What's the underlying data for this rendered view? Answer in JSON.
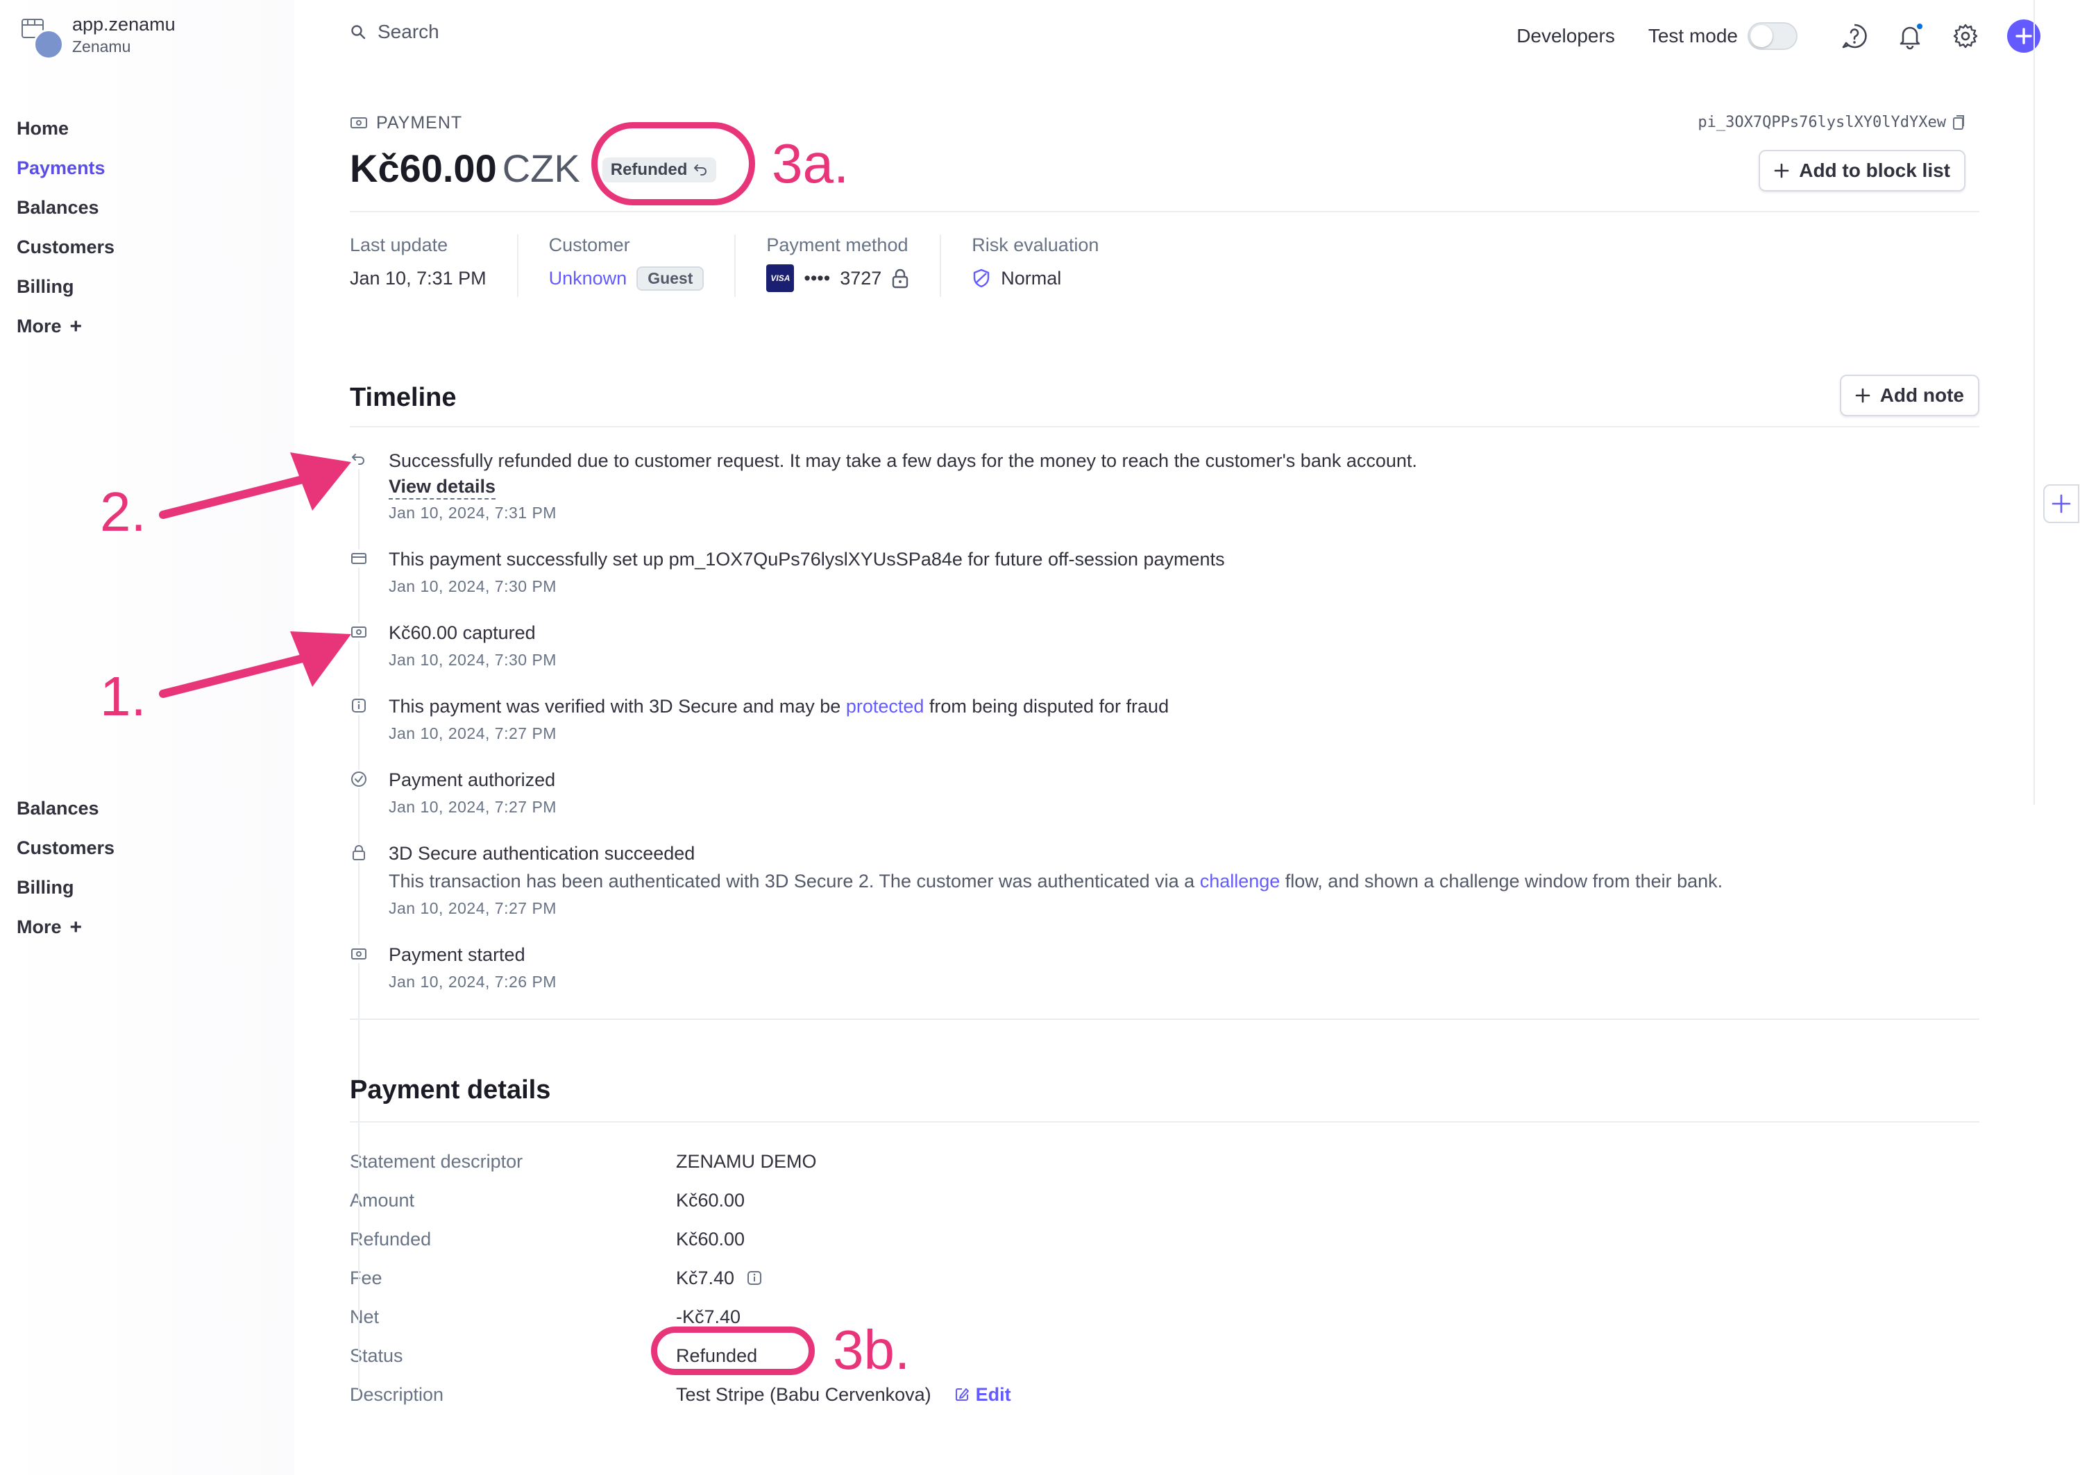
{
  "brand": {
    "name": "app.zenamu",
    "account": "Zenamu"
  },
  "sidebar": {
    "top_items": [
      {
        "label": "Home"
      },
      {
        "label": "Payments",
        "active": true
      },
      {
        "label": "Balances"
      },
      {
        "label": "Customers"
      },
      {
        "label": "Billing"
      },
      {
        "label": "More"
      }
    ],
    "bottom_items": [
      {
        "label": "Balances"
      },
      {
        "label": "Customers"
      },
      {
        "label": "Billing"
      },
      {
        "label": "More"
      }
    ]
  },
  "topbar": {
    "search_label": "Search",
    "developers_label": "Developers",
    "test_mode_label": "Test mode",
    "test_mode_on": false
  },
  "header": {
    "eyebrow": "PAYMENT",
    "payment_id": "pi_3OX7QPPs76lyslXY0lYdYXew",
    "amount": "Kč60.00",
    "currency": "CZK",
    "status": "Refunded",
    "block_list_label": "Add to block list"
  },
  "summary": {
    "last_update": {
      "label": "Last update",
      "value": "Jan 10, 7:31 PM"
    },
    "customer": {
      "label": "Customer",
      "value": "Unknown",
      "badge": "Guest"
    },
    "payment_method": {
      "label": "Payment method",
      "brand": "VISA",
      "dots": "••••",
      "last4": "3727"
    },
    "risk": {
      "label": "Risk evaluation",
      "value": "Normal"
    }
  },
  "timeline": {
    "title": "Timeline",
    "add_note_label": "Add note",
    "items": [
      {
        "icon": "refund-icon",
        "text": "Successfully refunded due to customer request. It may take a few days for the money to reach the customer's bank account.",
        "link": "View details",
        "date": "Jan 10, 2024, 7:31 PM"
      },
      {
        "icon": "card-icon",
        "text": "This payment successfully set up pm_1OX7QuPs76lyslXYUsSPa84e for future off-session payments",
        "date": "Jan 10, 2024, 7:30 PM"
      },
      {
        "icon": "money-icon",
        "text": "Kč60.00 captured",
        "date": "Jan 10, 2024, 7:30 PM"
      },
      {
        "icon": "info-icon",
        "text_before": "This payment was verified with 3D Secure and may be ",
        "text_link": "protected",
        "text_after": " from being disputed for fraud",
        "date": "Jan 10, 2024, 7:27 PM"
      },
      {
        "icon": "check-circle-icon",
        "text": "Payment authorized",
        "date": "Jan 10, 2024, 7:27 PM"
      },
      {
        "icon": "lock-icon",
        "text": "3D Secure authentication succeeded",
        "sub_before": "This transaction has been authenticated with 3D Secure 2. The customer was authenticated via a ",
        "sub_link": "challenge",
        "sub_after": " flow, and shown a challenge window from their bank.",
        "date": "Jan 10, 2024, 7:27 PM"
      },
      {
        "icon": "money-icon",
        "text": "Payment started",
        "date": "Jan 10, 2024, 7:26 PM"
      }
    ]
  },
  "details": {
    "title": "Payment details",
    "rows": [
      {
        "label": "Statement descriptor",
        "value": "ZENAMU DEMO"
      },
      {
        "label": "Amount",
        "value": "Kč60.00"
      },
      {
        "label": "Refunded",
        "value": "Kč60.00"
      },
      {
        "label": "Fee",
        "value": "Kč7.40"
      },
      {
        "label": "Net",
        "value": "-Kč7.40"
      },
      {
        "label": "Status",
        "value": "Refunded"
      },
      {
        "label": "Description",
        "value": "Test Stripe (Babu Cervenkova)",
        "edit_label": "Edit"
      }
    ]
  },
  "annotations": {
    "a1": "1.",
    "a2": "2.",
    "a3a": "3a.",
    "a3b": "3b."
  },
  "colors": {
    "accent": "#635bff",
    "annotation": "#e8357a",
    "text": "#30313d",
    "muted": "#687385"
  }
}
